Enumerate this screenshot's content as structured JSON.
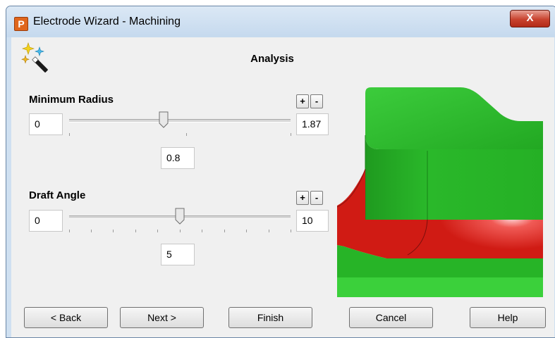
{
  "window": {
    "title": "Electrode Wizard - Machining",
    "close_label": "X",
    "app_icon_letter": "P"
  },
  "page": {
    "title": "Analysis",
    "icon": "magic-wand-sparkles-icon"
  },
  "minimum_radius": {
    "label": "Minimum Radius",
    "min_value": "0",
    "max_value": "1.87",
    "current_value": "0.8",
    "slider_fraction": 0.428,
    "plus_label": "+",
    "minus_label": "-"
  },
  "draft_angle": {
    "label": "Draft Angle",
    "min_value": "0",
    "max_value": "10",
    "current_value": "5",
    "slider_fraction": 0.5,
    "plus_label": "+",
    "minus_label": "-"
  },
  "preview": {
    "colors": {
      "pass": "#22b022",
      "fail": "#d01b14"
    }
  },
  "buttons": {
    "back": "< Back",
    "next": "Next >",
    "finish": "Finish",
    "cancel": "Cancel",
    "help": "Help"
  }
}
